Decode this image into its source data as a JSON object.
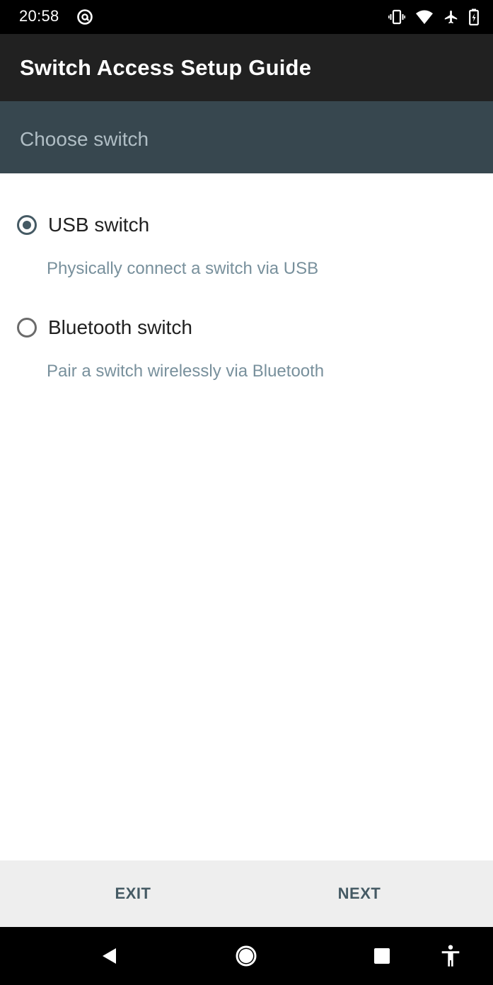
{
  "status_bar": {
    "time": "20:58",
    "left_icon": "at-sign-icon",
    "right_icons": [
      "vibrate-icon",
      "wifi-icon",
      "airplane-icon",
      "battery-icon"
    ]
  },
  "app_bar": {
    "title": "Switch Access Setup Guide"
  },
  "sub_header": {
    "title": "Choose switch"
  },
  "options": [
    {
      "label": "USB switch",
      "description": "Physically connect a switch via USB",
      "selected": true
    },
    {
      "label": "Bluetooth switch",
      "description": "Pair a switch wirelessly via Bluetooth",
      "selected": false
    }
  ],
  "bottom_bar": {
    "exit_label": "EXIT",
    "next_label": "NEXT"
  },
  "nav_bar": {
    "buttons": [
      "back-icon",
      "home-icon",
      "recents-icon",
      "accessibility-icon"
    ]
  },
  "colors": {
    "status_bar": "#000000",
    "app_bar": "#212121",
    "sub_header": "#37474f",
    "sub_header_text": "#b0bec5",
    "accent": "#455a64",
    "bottom_bar": "#eeeeee",
    "description_text": "#78909c"
  }
}
